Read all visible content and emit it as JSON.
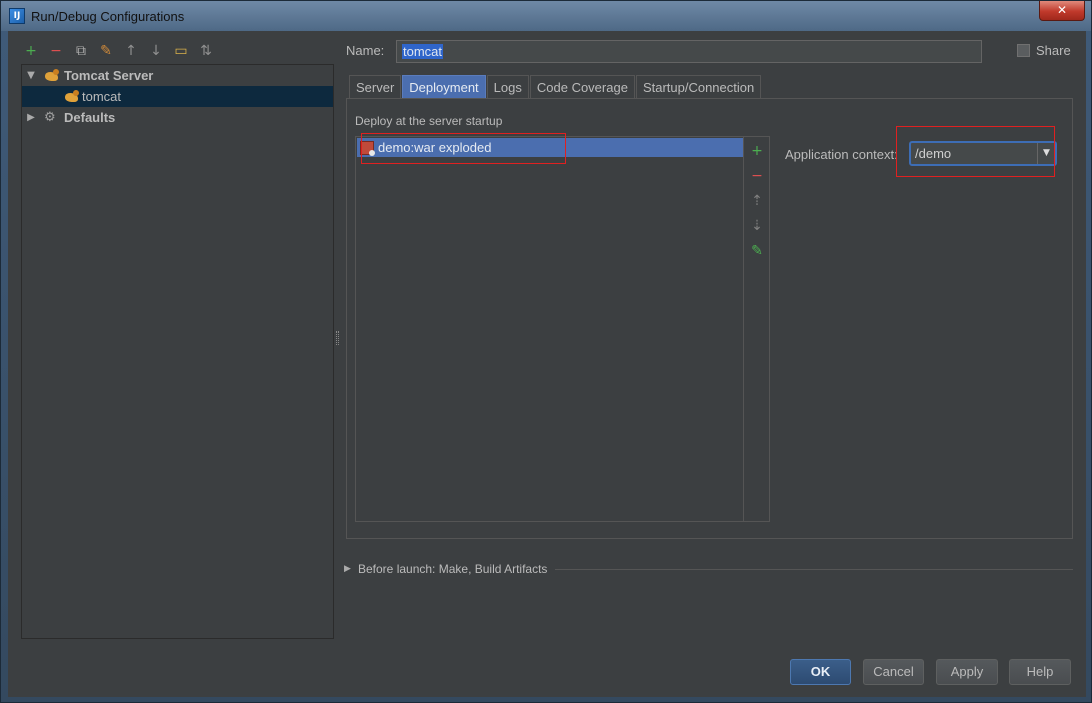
{
  "window": {
    "title": "Run/Debug Configurations",
    "close_glyph": "✕",
    "app_icon": "IJ"
  },
  "toolbar": [
    {
      "icon": "add-icon",
      "glyph": "+",
      "color": "#4caf50"
    },
    {
      "icon": "remove-icon",
      "glyph": "−",
      "color": "#e05050"
    },
    {
      "icon": "copy-icon",
      "glyph": "⧉",
      "color": "#b0b0b0"
    },
    {
      "icon": "wrench-icon",
      "glyph": "✎",
      "color": "#d08a3a"
    },
    {
      "icon": "move-up-icon",
      "glyph": "↑",
      "color": "#909090"
    },
    {
      "icon": "move-down-icon",
      "glyph": "↓",
      "color": "#909090"
    },
    {
      "icon": "folder-icon",
      "glyph": "▭",
      "color": "#d8b04a"
    },
    {
      "icon": "sort-icon",
      "glyph": "⇅",
      "color": "#909090"
    }
  ],
  "tree": {
    "root": {
      "label": "Tomcat Server",
      "arrow": "▼"
    },
    "child": {
      "label": "tomcat"
    },
    "defaults": {
      "label": "Defaults",
      "arrow": "▶"
    }
  },
  "config": {
    "name_label": "Name:",
    "name_value": "tomcat",
    "share_label": "Share"
  },
  "tabs": [
    {
      "label": "Server",
      "active": false
    },
    {
      "label": "Deployment",
      "active": true
    },
    {
      "label": "Logs",
      "active": false
    },
    {
      "label": "Code Coverage",
      "active": false
    },
    {
      "label": "Startup/Connection",
      "active": false
    }
  ],
  "deployment": {
    "title": "Deploy at the server startup",
    "artifacts": [
      "demo:war exploded"
    ],
    "side_tools": [
      {
        "icon": "add-icon",
        "glyph": "+",
        "color": "#4caf50"
      },
      {
        "icon": "remove-icon",
        "glyph": "−",
        "color": "#e05050"
      },
      {
        "icon": "move-up-icon",
        "glyph": "⇡",
        "color": "#808080"
      },
      {
        "icon": "move-down-icon",
        "glyph": "⇣",
        "color": "#808080"
      },
      {
        "icon": "edit-icon",
        "glyph": "✎",
        "color": "#4caf50"
      }
    ],
    "context_label": "Application context:",
    "context_value": "/demo",
    "dropdown_glyph": "▼"
  },
  "before_launch": {
    "arrow": "▶",
    "label": "Before launch: Make, Build Artifacts"
  },
  "buttons": {
    "ok": "OK",
    "cancel": "Cancel",
    "apply": "Apply",
    "help": "Help"
  },
  "colors": {
    "background": "#3c3f41",
    "selection": "#4b6eaf",
    "highlight": "#e02020"
  }
}
